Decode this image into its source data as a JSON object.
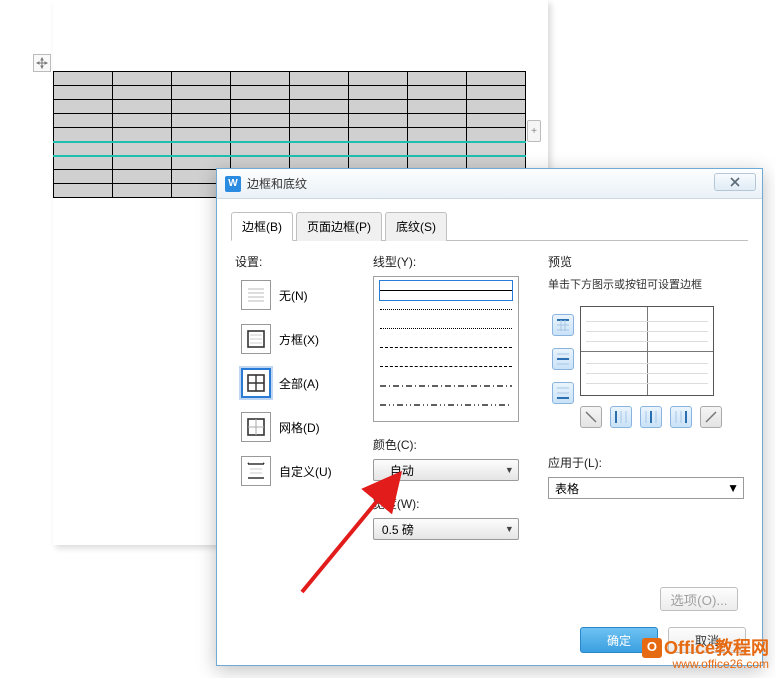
{
  "dialog": {
    "title": "边框和底纹",
    "tabs": {
      "border": "边框(B)",
      "page_border": "页面边框(P)",
      "shading": "底纹(S)"
    },
    "settings": {
      "label": "设置:",
      "none": "无(N)",
      "box": "方框(X)",
      "all": "全部(A)",
      "grid": "网格(D)",
      "custom": "自定义(U)"
    },
    "line_style": {
      "label": "线型(Y):"
    },
    "color": {
      "label": "颜色(C):",
      "value": "自动"
    },
    "width": {
      "label": "宽度(W):",
      "value": "0.5 磅"
    },
    "preview": {
      "label": "预览",
      "hint": "单击下方图示或按钮可设置边框"
    },
    "apply_to": {
      "label": "应用于(L):",
      "value": "表格"
    },
    "options_btn": "选项(O)...",
    "ok": "确定",
    "cancel": "取消"
  },
  "watermark": {
    "line1": "Office教程网",
    "line2": "www.office26.com"
  }
}
